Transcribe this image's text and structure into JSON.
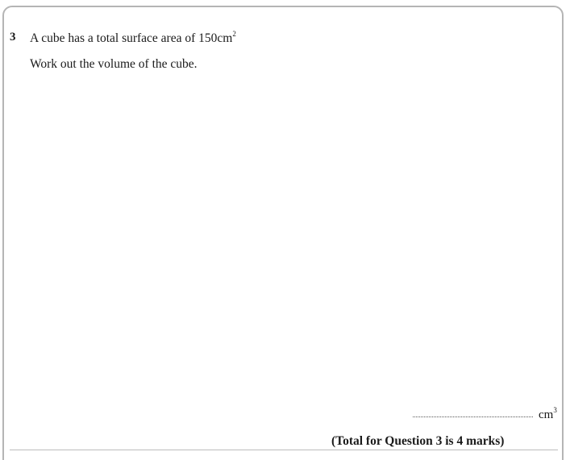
{
  "question": {
    "number": "3",
    "text": "A cube has a total surface area of 150",
    "text_unit": "cm",
    "text_unit_power": "2",
    "instruction": "Work out the volume of the cube."
  },
  "answer": {
    "unit": "cm",
    "unit_power": "3"
  },
  "footer": {
    "total": "(Total for Question 3 is 4 marks)"
  }
}
